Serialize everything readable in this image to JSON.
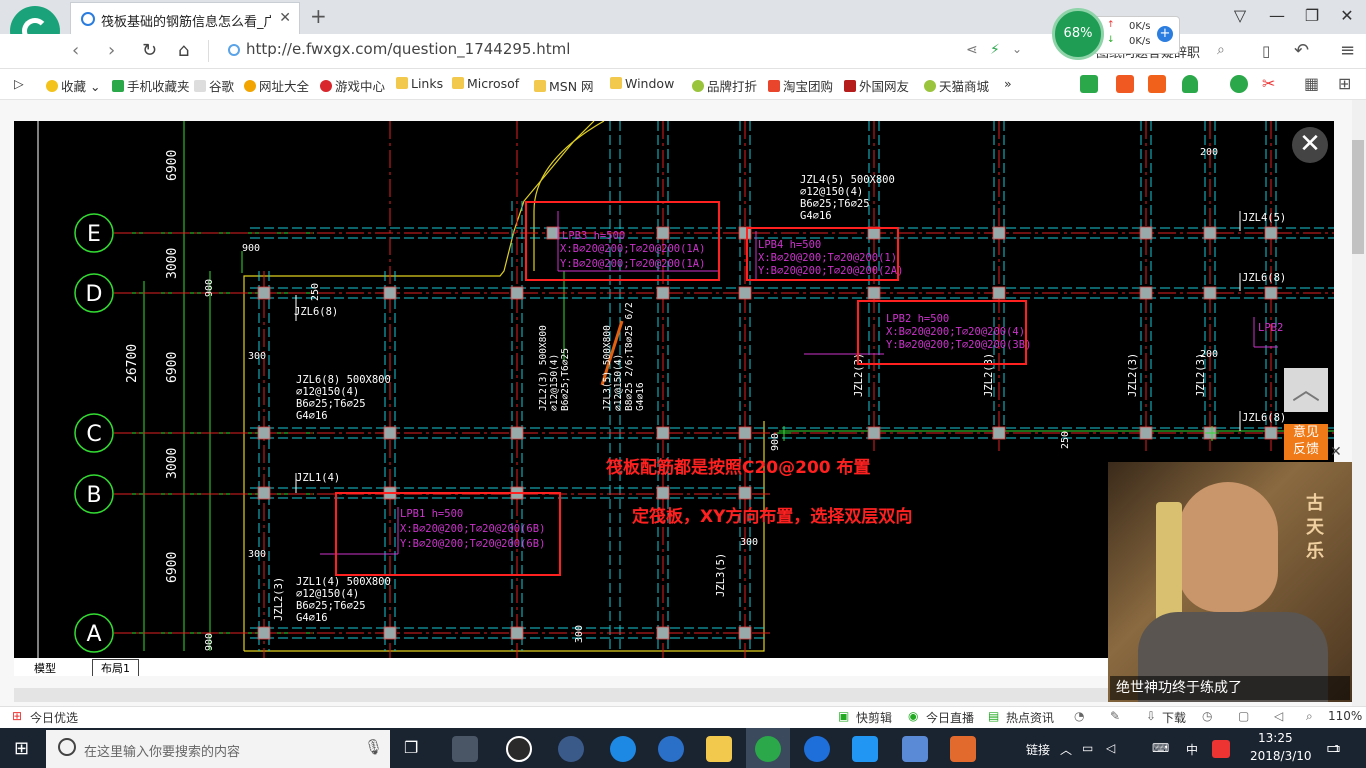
{
  "browser": {
    "tab_title": "筏板基础的钢筋信息怎么看_广联",
    "tab_close": "✕",
    "new_tab": "+",
    "url": "http://e.fwxgx.com/question_1744295.html",
    "url_right_fragment": "图纸问题答疑辞职",
    "speed_percent": "68%",
    "upload_speed": "0K/s",
    "download_speed": "0K/s",
    "window_controls": [
      "▽",
      "—",
      "❐",
      "✕"
    ]
  },
  "bookmarks": [
    "收藏",
    "手机收藏夹",
    "谷歌",
    "网址大全",
    "游戏中心",
    "Links",
    "Microsof",
    "MSN 网",
    "Window",
    "品牌打折",
    "淘宝团购",
    "外国网友",
    "天猫商城"
  ],
  "cad": {
    "annotations": {
      "line1": "筏板配筋都是按照C20@200 布置",
      "line2": "定筏板，XY方向布置，选择双层双向"
    },
    "axis_labels": [
      "E",
      "D",
      "C",
      "B",
      "A"
    ],
    "dims_left": [
      "6900",
      "3000",
      "6900",
      "3000",
      "6900",
      "26700"
    ],
    "dims_small": [
      "900",
      "900",
      "900",
      "300",
      "300",
      "250",
      "250",
      "900",
      "200",
      "200",
      "300",
      "300"
    ],
    "slabs": [
      {
        "name": "LPB3 h=500",
        "x": "X:B⌀20@200;T⌀20@200(1A)",
        "y": "Y:B⌀20@200;T⌀20@200(1A)"
      },
      {
        "name": "LPB4 h=500",
        "x": "X:B⌀20@200;T⌀20@200(1)",
        "y": "Y:B⌀20@200;T⌀20@200(2A)"
      },
      {
        "name": "LPB2 h=500",
        "x": "X:B⌀20@200;T⌀20@200(4)",
        "y": "Y:B⌀20@200;T⌀20@200(3B)"
      },
      {
        "name": "LPB1 h=500",
        "x": "X:B⌀20@200;T⌀20@200(6B)",
        "y": "Y:B⌀20@200;T⌀20@200(6B)"
      }
    ],
    "beams": [
      {
        "name": "JZL4(5)  500X800",
        "l2": "⌀12@150(4)",
        "l3": "B6⌀25;T6⌀25",
        "l4": "G4⌀16"
      },
      {
        "name": "JZL6(8)  500X800",
        "l2": "⌀12@150(4)",
        "l3": "B6⌀25;T6⌀25",
        "l4": "G4⌀16"
      },
      {
        "name": "JZL1(4)  500X800",
        "l2": "⌀12@150(4)",
        "l3": "B6⌀25;T6⌀25",
        "l4": "G4⌀16"
      }
    ],
    "labels_misc": [
      "JZL6(8)",
      "JZL4(5)",
      "JZL6(8)",
      "JZL1(4)",
      "JZL6(8)",
      "LPB2",
      "JZL2(3)",
      "JZL3(5)"
    ],
    "tabs": [
      "模型",
      "布局1"
    ]
  },
  "overlay": {
    "close": "✕",
    "up": "︿",
    "feedback": "意见\n反馈",
    "video_caption": "绝世神功终于练成了",
    "video_brand": "古天乐",
    "video_close": "✕"
  },
  "statusbar": {
    "left": "今日优选",
    "items": [
      "快剪辑",
      "今日直播",
      "热点资讯"
    ],
    "download": "下载",
    "zoom": "110%"
  },
  "taskbar": {
    "search_placeholder": "在这里输入你要搜索的内容",
    "ime_link": "链接",
    "ime_lang": "中",
    "time": "13:25",
    "date": "2018/3/10",
    "notification_count": "1"
  },
  "colors": {
    "cad_bg": "#000000",
    "grid_cyan": "#19c9d3",
    "axis_red": "#e02020",
    "dim_green": "#33dd33",
    "slab_magenta": "#cc33cc",
    "highlight_red": "#ff2020"
  }
}
